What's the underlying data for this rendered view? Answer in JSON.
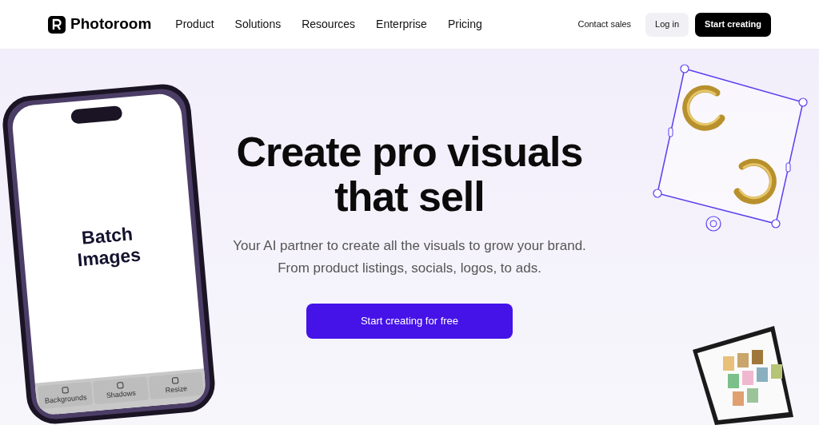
{
  "header": {
    "logo": "Photoroom",
    "nav": [
      {
        "label": "Product"
      },
      {
        "label": "Solutions"
      },
      {
        "label": "Resources"
      },
      {
        "label": "Enterprise"
      },
      {
        "label": "Pricing"
      }
    ],
    "contact": "Contact sales",
    "login": "Log in",
    "cta": "Start creating"
  },
  "hero": {
    "title_lines": [
      "Create pro visuals",
      "that sell"
    ],
    "subtitle_lines": [
      "Your AI partner to create all the visuals to grow your brand.",
      "From product listings, socials, logos, to ads."
    ],
    "cta": "Start creating for free"
  },
  "phone": {
    "screen_text_lines": [
      "Batch",
      "Images"
    ],
    "tabs": [
      {
        "label": "Backgrounds"
      },
      {
        "label": "Shadows"
      },
      {
        "label": "Resize"
      }
    ]
  }
}
